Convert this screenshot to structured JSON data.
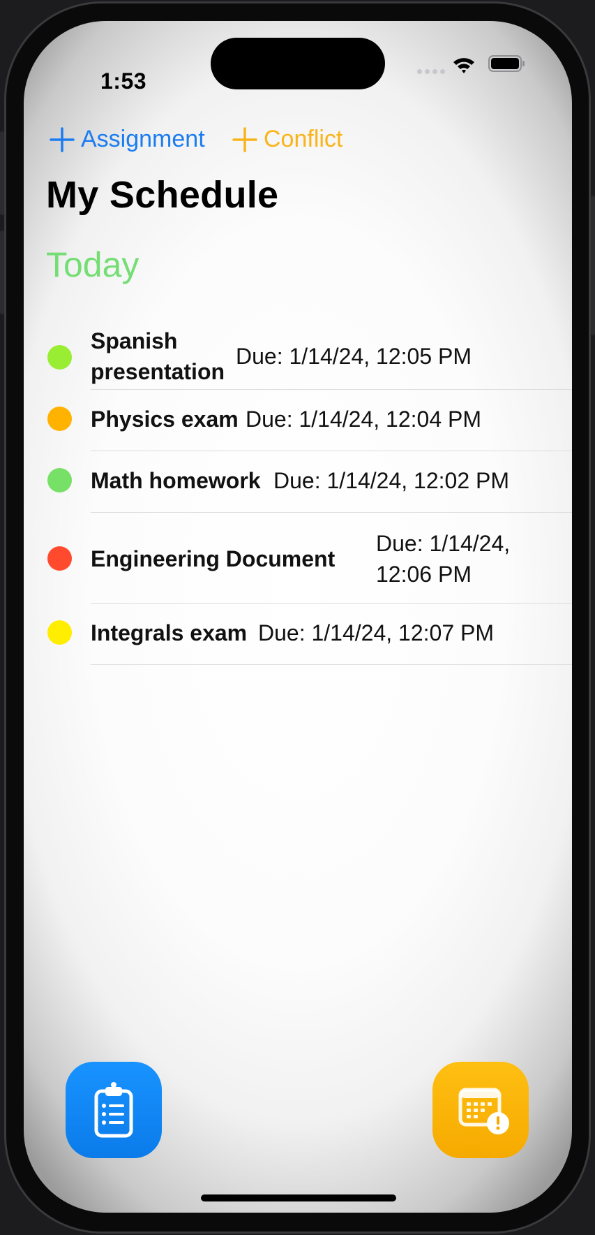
{
  "status_bar": {
    "time": "1:53"
  },
  "toolbar": {
    "add_assignment_label": "Assignment",
    "add_conflict_label": "Conflict"
  },
  "page_title": "My Schedule",
  "section": {
    "title": "Today"
  },
  "assignments": [
    {
      "title_line1": "Spanish",
      "title_line2": "presentation",
      "due": "Due: 1/14/24, 12:05 PM",
      "color": "#99ee33"
    },
    {
      "title": "Physics exam",
      "due": "Due: 1/14/24, 12:04 PM",
      "color": "#ffb300"
    },
    {
      "title": "Math homework",
      "due": "Due: 1/14/24, 12:02 PM",
      "color": "#77e066"
    },
    {
      "title": "Engineering Document",
      "due_line1": "Due: 1/14/24,",
      "due_line2": "12:06 PM",
      "color": "#ff4a2e"
    },
    {
      "title": "Integrals exam",
      "due": "Due: 1/14/24, 12:07 PM",
      "color": "#ffee00"
    }
  ],
  "bottom_actions": {
    "left_icon": "clipboard-list-icon",
    "right_icon": "calendar-alert-icon"
  },
  "colors": {
    "accent_blue": "#1a7cf0",
    "accent_orange": "#f8b41a",
    "section_green": "#74de74"
  }
}
